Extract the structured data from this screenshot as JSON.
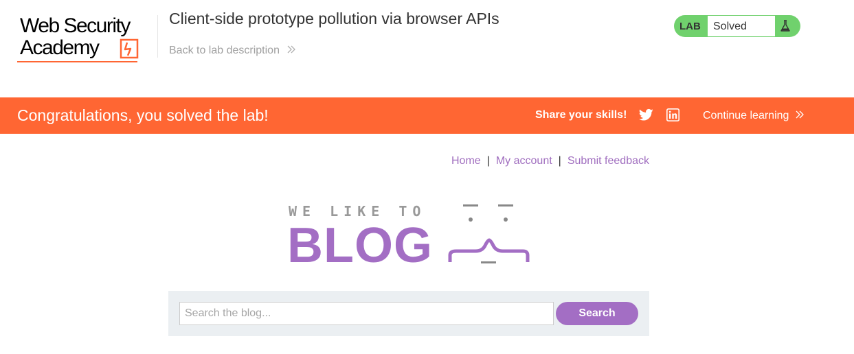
{
  "header": {
    "logo_line1": "Web Security",
    "logo_line2": "Academy",
    "lab_title": "Client-side prototype pollution via browser APIs",
    "back_link": "Back to lab description",
    "lab_badge": "LAB",
    "lab_status": "Solved"
  },
  "banner": {
    "message": "Congratulations, you solved the lab!",
    "share_label": "Share your skills!",
    "continue_label": "Continue learning"
  },
  "nav": {
    "items": [
      "Home",
      "My account",
      "Submit feedback"
    ],
    "separator": "|"
  },
  "blog_logo": {
    "tagline": "WE LIKE TO",
    "word": "BLOG"
  },
  "search": {
    "placeholder": "Search the blog...",
    "value": "",
    "button_label": "Search"
  },
  "colors": {
    "accent_orange": "#ff6633",
    "blog_purple": "#a36ec4",
    "lab_green": "#70d16d",
    "search_panel_bg": "#ebeff2"
  },
  "icons": {
    "logo": "web-security-academy-logo-icon",
    "back": "double-chevron-right-icon",
    "flask": "flask-icon",
    "twitter": "twitter-icon",
    "linkedin": "linkedin-icon",
    "continue": "double-chevron-right-icon"
  }
}
